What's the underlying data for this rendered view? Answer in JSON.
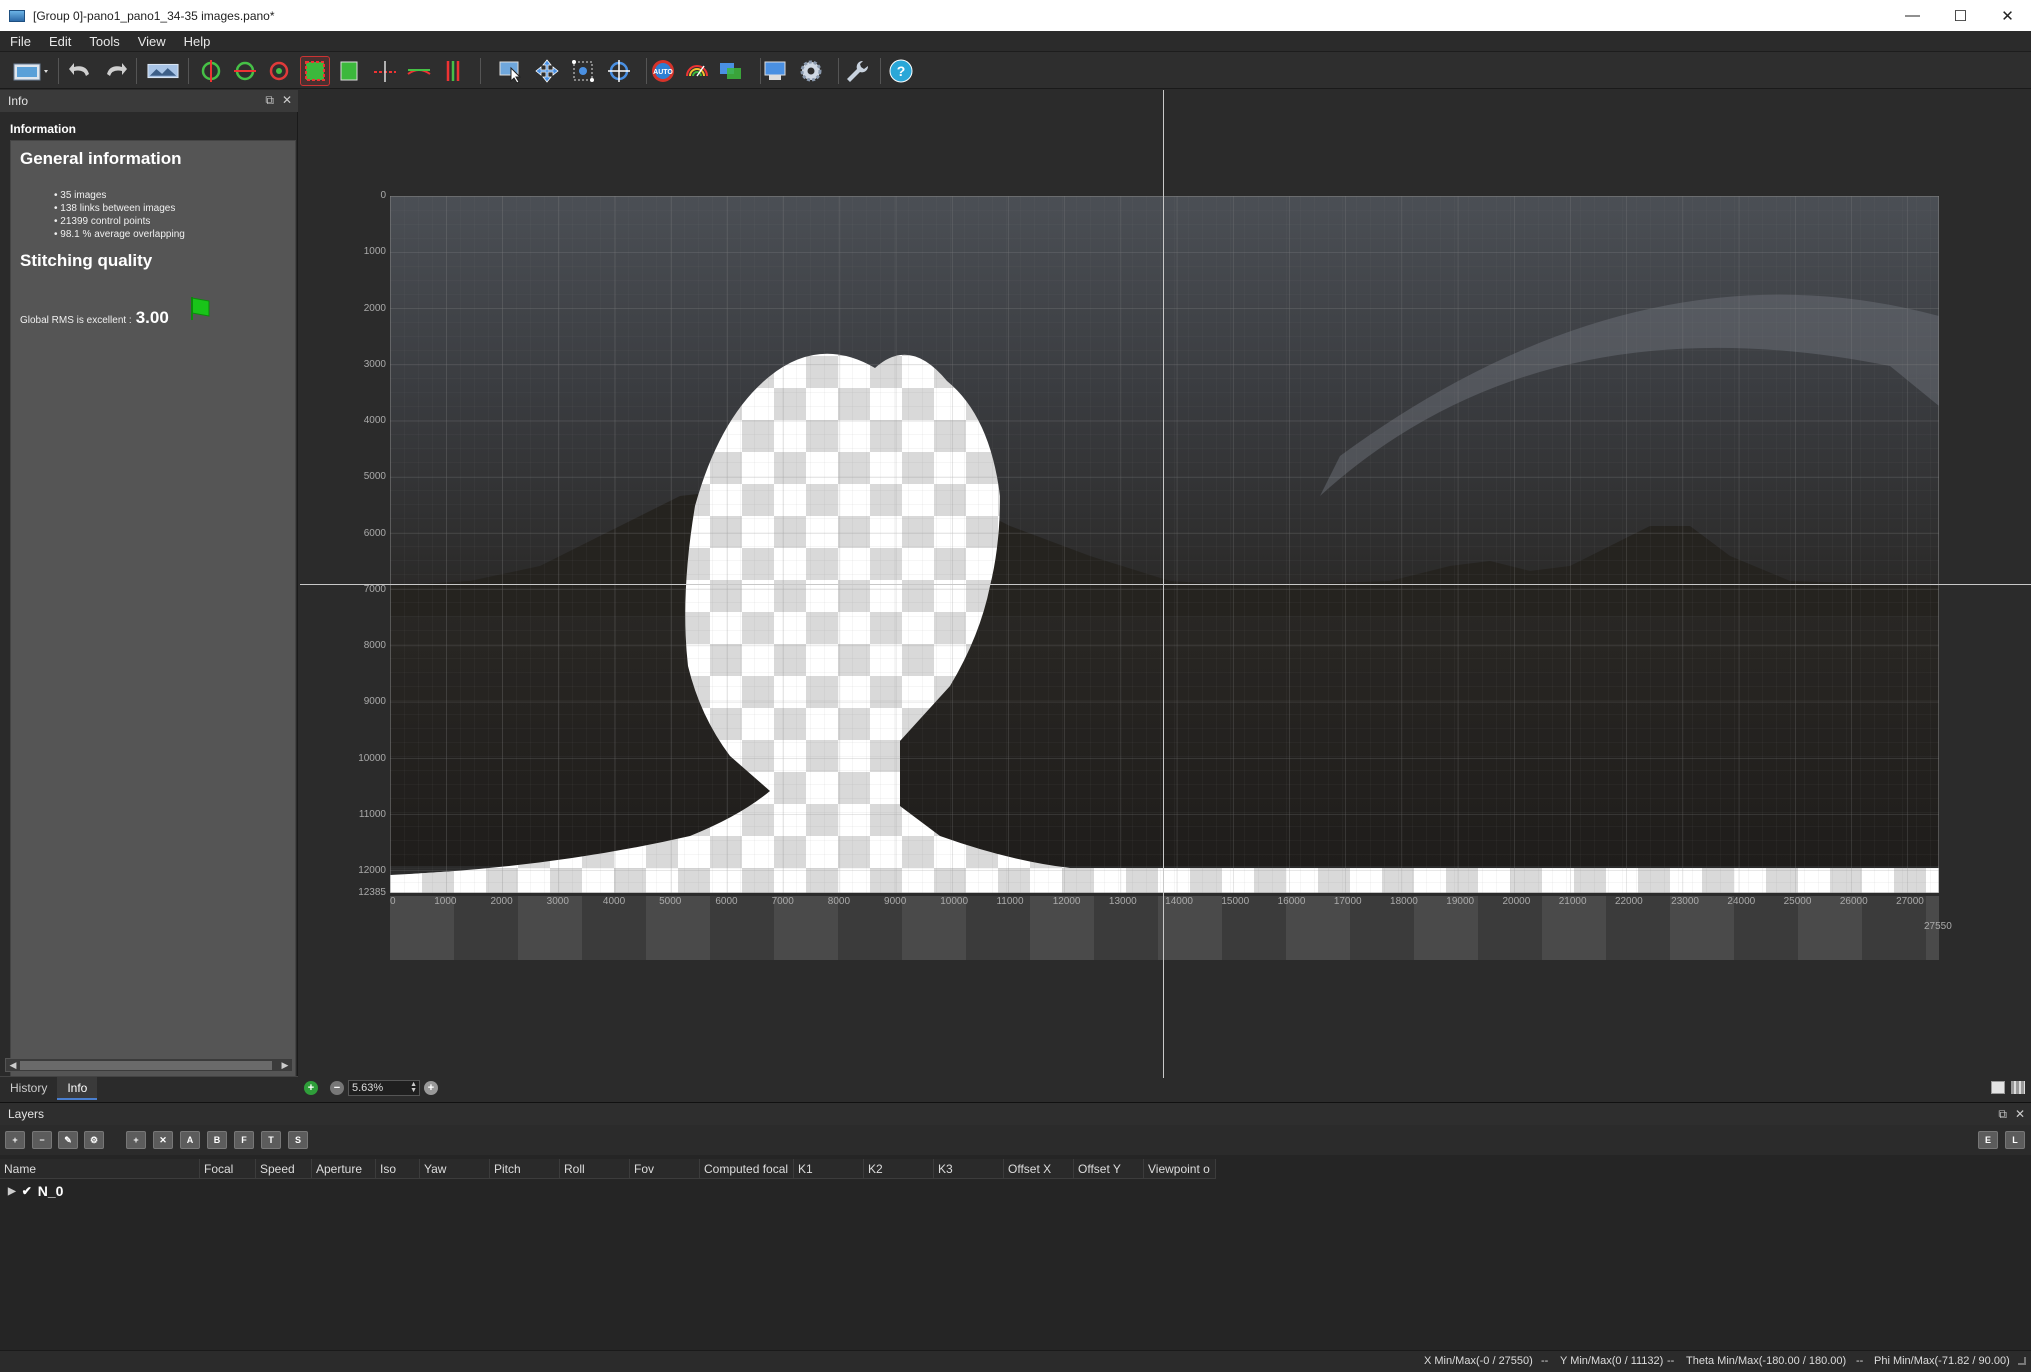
{
  "window": {
    "title": "[Group 0]-pano1_pano1_34-35 images.pano*",
    "minimize": "—",
    "maximize": "☐",
    "close": "✕"
  },
  "menu": {
    "items": [
      "File",
      "Edit",
      "Tools",
      "View",
      "Help"
    ]
  },
  "toolbar": {
    "auto_label": "AUTO"
  },
  "info_panel": {
    "header": "Info",
    "subheader": "Information",
    "general_title": "General information",
    "stats": [
      "35 images",
      "138 links between images",
      "21399 control points",
      "98.1 % average overlapping"
    ],
    "stitching_title": "Stitching quality",
    "rms_label": "Global RMS is excellent :",
    "rms_value": "3.00",
    "tabs": [
      "History",
      "Info"
    ]
  },
  "canvas": {
    "y_ticks": [
      "0",
      "1000",
      "2000",
      "3000",
      "4000",
      "5000",
      "6000",
      "7000",
      "8000",
      "9000",
      "10000",
      "11000",
      "12000",
      "12385"
    ],
    "x_ticks": [
      "0",
      "1000",
      "2000",
      "3000",
      "4000",
      "5000",
      "6000",
      "7000",
      "8000",
      "9000",
      "10000",
      "11000",
      "12000",
      "13000",
      "14000",
      "15000",
      "16000",
      "17000",
      "18000",
      "19000",
      "20000",
      "21000",
      "22000",
      "23000",
      "24000",
      "25000",
      "26000",
      "27000"
    ],
    "x_max_label": "27550",
    "zoom_value": "5.63%"
  },
  "layers_panel": {
    "header": "Layers",
    "tool_letters": [
      "A",
      "B",
      "F",
      "T",
      "S"
    ],
    "right_tools": [
      "E",
      "L"
    ],
    "columns": [
      "Name",
      "Focal",
      "Speed",
      "Aperture",
      "Iso",
      "Yaw",
      "Pitch",
      "Roll",
      "Fov",
      "Computed focal",
      "K1",
      "K2",
      "K3",
      "Offset X",
      "Offset Y",
      "Viewpoint o"
    ],
    "row_name": "N_0"
  },
  "status": {
    "x": "X Min/Max(-0 / 27550)",
    "y": "Y Min/Max(0 / 11132)",
    "theta": "Theta Min/Max(-180.00 / 180.00)",
    "phi": "Phi Min/Max(-71.82 / 90.00)",
    "sep": "--"
  }
}
